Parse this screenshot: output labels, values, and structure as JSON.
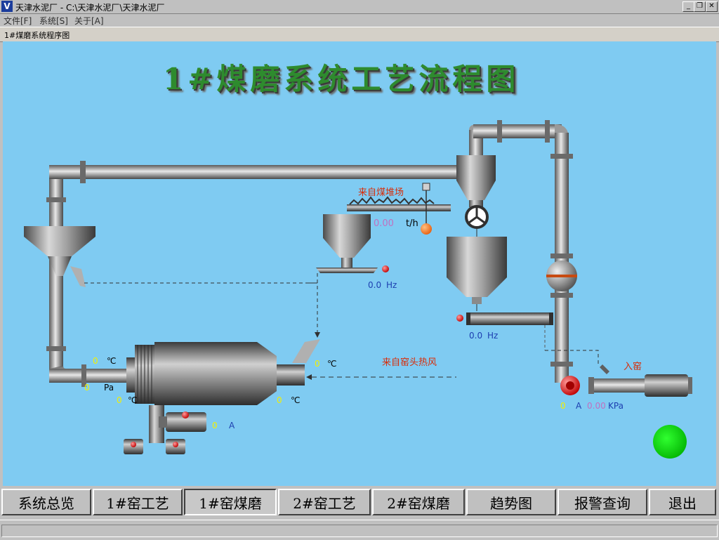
{
  "window": {
    "app_logo": "V",
    "title": "天津水泥厂 - C:\\天津水泥厂\\天津水泥厂",
    "minimize": "_",
    "restore": "❐",
    "close": "✕"
  },
  "menu": [
    {
      "label": "文件[F]"
    },
    {
      "label": "系统[S]"
    },
    {
      "label": "关于[A]"
    }
  ],
  "doc_tab": "1#煤磨系统程序图",
  "diagram": {
    "title": "1#煤磨系统工艺流程图",
    "labels": {
      "coal_yard": "来自煤堆场",
      "kiln_hot_air": "来自窑头热风",
      "to_kiln": "入窑"
    },
    "readings": {
      "feeder_flow": "0.00",
      "feeder_flow_unit": "t/h",
      "coal_feeder_freq": "0.0",
      "coal_feeder_freq_unit": "Hz",
      "screw_freq": "0.0",
      "screw_freq_unit": "Hz",
      "mill_outlet_temp": "0",
      "mill_outlet_temp_unit": "℃",
      "mill_outlet_pressure": "0",
      "mill_outlet_pressure_unit": "Pa",
      "mill_bearing_temp": "0",
      "mill_bearing_temp_unit": "℃",
      "mill_inlet_temp": "0",
      "mill_inlet_temp_unit": "℃",
      "hot_air_temp": "0",
      "hot_air_temp_unit": "℃",
      "motor_current": "0",
      "motor_current_unit": "A",
      "fan_current": "0",
      "fan_current_unit": "A",
      "fan_pressure": "0.00",
      "fan_pressure_unit": "KPa"
    },
    "colors": {
      "background": "#7fcbf2",
      "run_indicator": "#00d000",
      "alarm_indicator": "#e00000",
      "pipe": "#8c8c8c"
    }
  },
  "nav": [
    {
      "label": "系统总览"
    },
    {
      "label": "1#窑工艺"
    },
    {
      "label": "1#窑煤磨",
      "active": true
    },
    {
      "label": "2#窑工艺"
    },
    {
      "label": "2#窑煤磨"
    },
    {
      "label": "趋势图"
    },
    {
      "label": "报警查询"
    },
    {
      "label": "退出"
    }
  ]
}
